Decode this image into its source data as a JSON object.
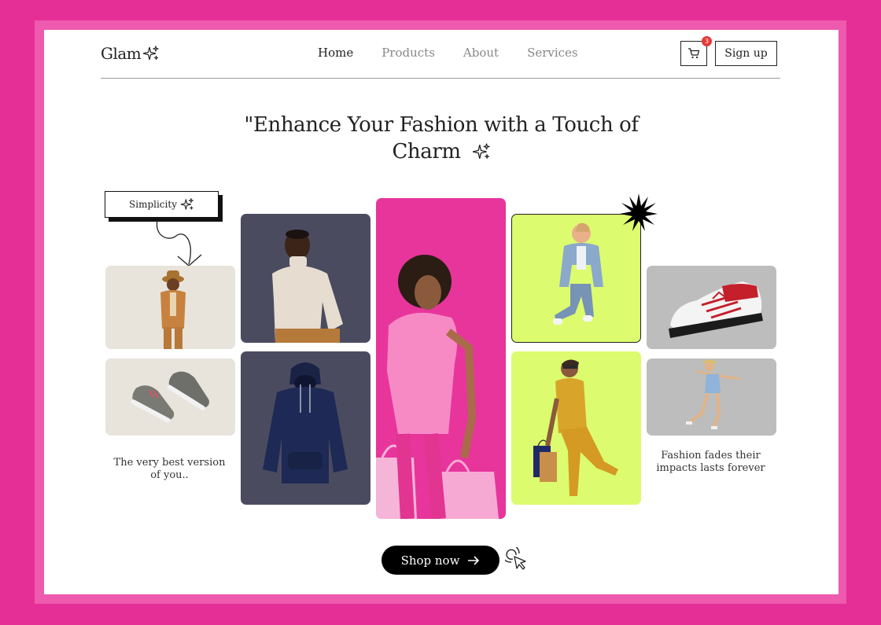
{
  "brand": {
    "logo_text": "Glam"
  },
  "nav": {
    "items": [
      {
        "label": "Home",
        "active": true
      },
      {
        "label": "Products",
        "active": false
      },
      {
        "label": "About",
        "active": false
      },
      {
        "label": "Services",
        "active": false
      }
    ]
  },
  "header": {
    "cart_count": "3",
    "signup_label": "Sign up"
  },
  "hero": {
    "headline_line1": "\"Enhance Your Fashion with a Touch of",
    "headline_line2": "Charm",
    "tag_label": "Simplicity",
    "caption_left": "The very best version of you..",
    "caption_right": "Fashion fades their impacts lasts forever",
    "cta_label": "Shop now"
  },
  "colors": {
    "brand_pink": "#e52f96",
    "lime": "#dcfb6e",
    "slate": "#4b4b60",
    "cream": "#e8e4dc",
    "grey": "#bdbdbd",
    "black": "#000000"
  },
  "icons": [
    "sparkle-icon",
    "cart-icon",
    "arrow-right-icon",
    "cursor-click-icon",
    "starburst-icon",
    "curved-arrow-icon"
  ]
}
